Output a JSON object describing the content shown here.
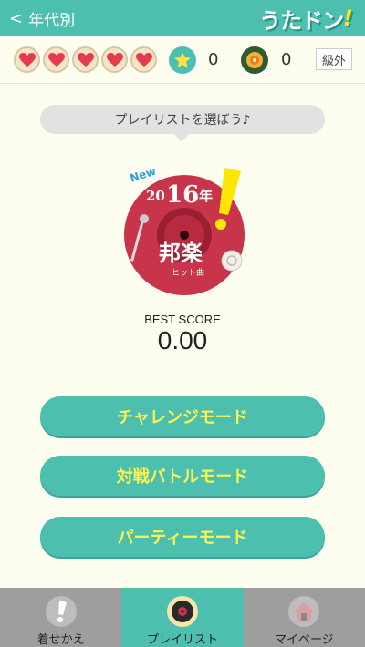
{
  "header": {
    "back_label": "年代別",
    "logo_text": "うたドン",
    "logo_exclaim": "!"
  },
  "status": {
    "hearts_count": 5,
    "star_count": "0",
    "medal_count": "0",
    "rank_label": "級外"
  },
  "bubble": {
    "text": "プレイリストを選ぼう♪"
  },
  "playlist_art": {
    "new_label": "New",
    "year_prefix": "20",
    "year_main": "16",
    "year_suffix": "年",
    "genre": "邦楽",
    "subtitle": "ヒット曲"
  },
  "score": {
    "label": "BEST SCORE",
    "value": "0.00"
  },
  "modes": [
    {
      "label": "チャレンジモード"
    },
    {
      "label": "対戦バトルモード"
    },
    {
      "label": "パーティーモード"
    }
  ],
  "nav": [
    {
      "label": "着せかえ",
      "active": false
    },
    {
      "label": "プレイリスト",
      "active": true
    },
    {
      "label": "マイページ",
      "active": false
    }
  ],
  "colors": {
    "teal": "#4dbfae",
    "cream": "#fdfdf0",
    "yellow_text": "#fff44f",
    "record_red": "#c8344a",
    "nav_gray": "#9e9e9e"
  }
}
